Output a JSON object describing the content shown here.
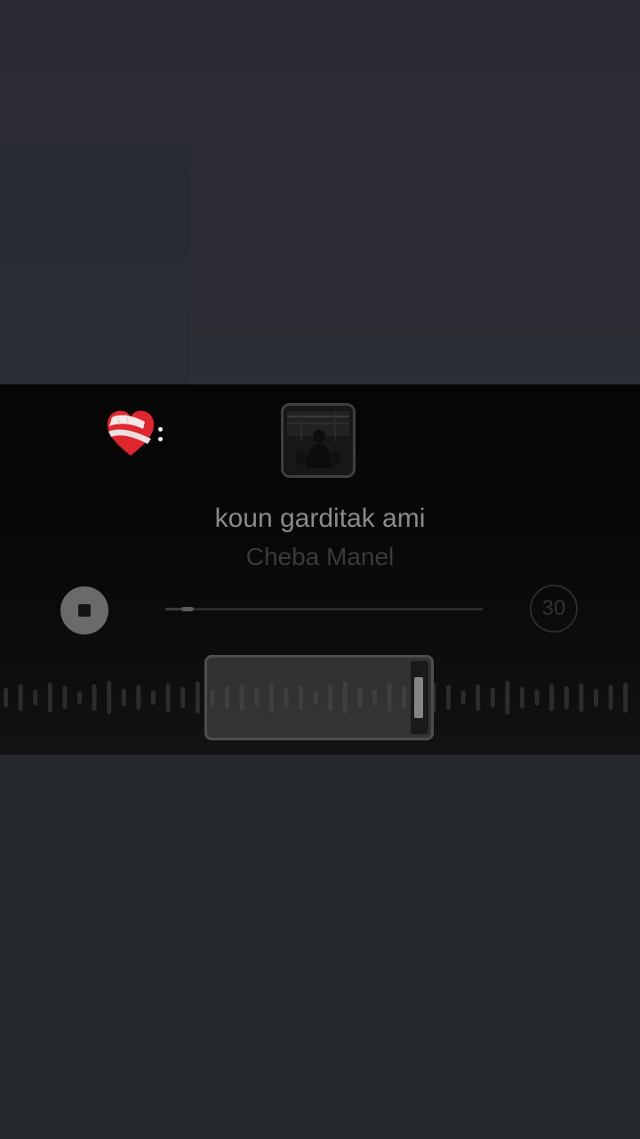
{
  "song": {
    "title": "koun garditak ami",
    "artist": "Cheba Manel"
  },
  "clip": {
    "duration_label": "30",
    "progress_fraction": 0.07
  },
  "icons": {
    "mending_heart": "mending-heart-emoji",
    "more_options": "vertical-dots-icon",
    "stop": "stop-icon"
  },
  "colors": {
    "panel_background": "#0a0a0a",
    "heart_red": "#e0262e",
    "title_text": "#8a8a8a",
    "artist_text": "#3a3a3a"
  }
}
